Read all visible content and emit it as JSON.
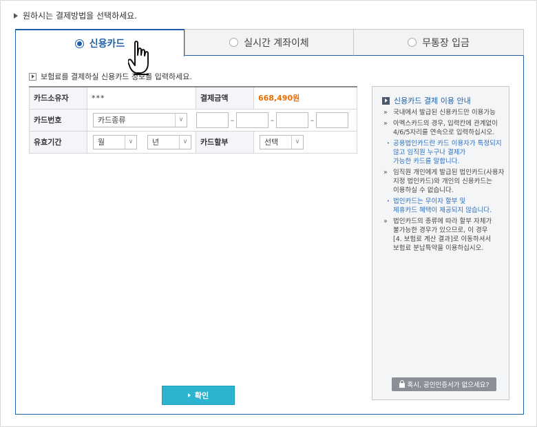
{
  "heading": "원하시는 결제방법을 선택하세요.",
  "tabs": [
    {
      "label": "신용카드",
      "selected": true
    },
    {
      "label": "실시간 계좌이체",
      "selected": false
    },
    {
      "label": "무통장 입금",
      "selected": false
    }
  ],
  "section_note": "보험료를 결제하실 신용카드 정보를 입력하세요.",
  "form": {
    "holder_label": "카드소유자",
    "holder_value": "***",
    "amount_label": "결제금액",
    "amount_value": "668,490원",
    "card_number_label": "카드번호",
    "card_type_selected": "카드종류",
    "expiry_label": "유효기간",
    "expiry_month_selected": "월",
    "expiry_year_selected": "년",
    "installment_label": "카드할부",
    "installment_selected": "선택"
  },
  "info": {
    "title": "신용카드 결제 이용 안내",
    "items": [
      {
        "text": "국내에서 발급된 신용카드만 이용가능",
        "type": "bullet"
      },
      {
        "text": "아멕스카드의 경우, 입력칸에 관계없이\n4/6/5자리를 연속으로 입력하십시오.",
        "type": "bullet"
      },
      {
        "text": "공용법인카드란 카드 이용자가 특정되지\n않고 임직원 누구나 결제가\n가능한 카드를 말합니다.",
        "type": "sub"
      },
      {
        "text": "임직원 개인에게 발급된 법인카드(사용자\n지정 법인카드)와 개인의 신용카드는\n이용하실 수 없습니다.",
        "type": "bullet"
      },
      {
        "text": "법인카드는 무이자 할부 및\n제휴카드 혜택이 제공되지 않습니다.",
        "type": "sub"
      },
      {
        "text": "법인카드의 종류에 따라 할부 자체가\n불가능한 경우가 있으므로, 이 경우\n[4. 보험료 계산 결과]로 이동하셔서\n보험료 분납특약을 이용하십시오.",
        "type": "bullet"
      }
    ],
    "cert_button": "혹시, 공인인증서가 없으세요?"
  },
  "confirm_button": "확인",
  "colors": {
    "accent": "#1f5fa8",
    "amount": "#ee6b00",
    "confirm": "#2ab4cf"
  }
}
